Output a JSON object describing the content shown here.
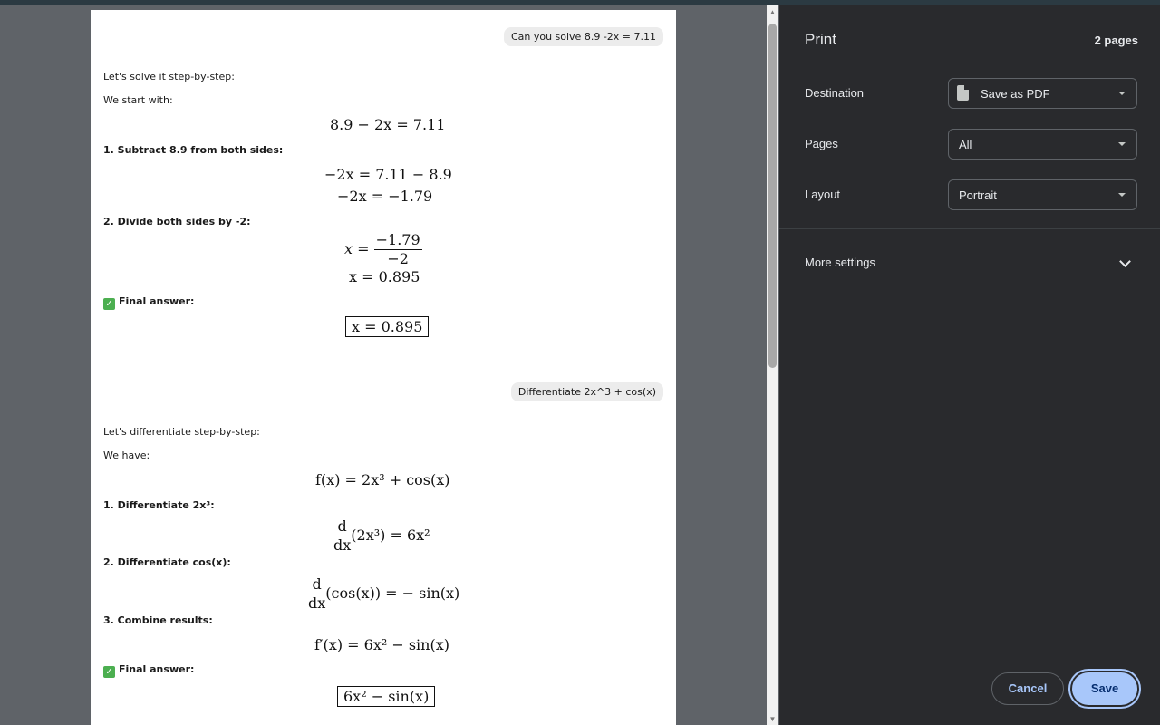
{
  "preview": {
    "bubble1": "Can you solve 8.9 -2x = 7.11",
    "s1_intro": "Let's solve it step-by-step:",
    "s1_start": "We start with:",
    "s1_eq_start": "8.9 − 2x = 7.11",
    "s1_step1": "1. Subtract 8.9 from both sides:",
    "s1_eq1a": "−2x = 7.11 − 8.9",
    "s1_eq1b": "−2x = −1.79",
    "s1_step2": "2. Divide both sides by -2:",
    "s1_frac_num": "−1.79",
    "s1_frac_den": "−2",
    "s1_eq2b": "x = 0.895",
    "final_label": "Final answer:",
    "s1_final": "x = 0.895",
    "bubble2": "Differentiate 2x^3 + cos(x)",
    "s2_intro": "Let's differentiate step-by-step:",
    "s2_have": "We have:",
    "s2_eq_f": "f(x) = 2x³ + cos(x)",
    "s2_step1": "1. Differentiate 2x³:",
    "s2_eq1": "(2x³) = 6x²",
    "s2_step2": "2. Differentiate cos(x):",
    "s2_eq2": "(cos(x)) = − sin(x)",
    "s2_step3": "3. Combine results:",
    "s2_eq3": "f′(x) = 6x² − sin(x)",
    "s2_final": "6x² − sin(x)",
    "d_num": "d",
    "d_den": "dx"
  },
  "panel": {
    "title": "Print",
    "page_count": "2 pages",
    "destination_label": "Destination",
    "destination_value": "Save as PDF",
    "pages_label": "Pages",
    "pages_value": "All",
    "layout_label": "Layout",
    "layout_value": "Portrait",
    "more_settings": "More settings",
    "cancel": "Cancel",
    "save": "Save"
  }
}
